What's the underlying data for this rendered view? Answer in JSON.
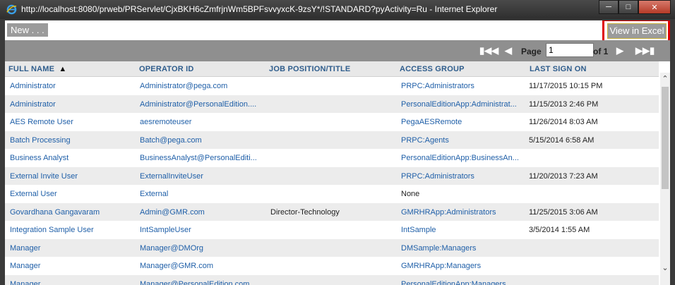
{
  "window": {
    "title": "http://localhost:8080/prweb/PRServlet/CjxBKH6cZmfrjnWm5BPFsvvyxcK-9zsY*/!STANDARD?pyActivity=Ru - Internet Explorer",
    "minimize_icon": "minimize-icon",
    "maximize_icon": "maximize-icon",
    "close_icon": "close-icon"
  },
  "toolbar": {
    "new_label": "New . . .",
    "excel_label": "View in Excel"
  },
  "pager": {
    "page_label": "Page",
    "page_value": "1",
    "of_label": "of 1"
  },
  "columns": {
    "full_name": "FULL NAME",
    "sort_indicator": "▲",
    "operator_id": "OPERATOR ID",
    "job_position": "JOB POSITION/TITLE",
    "access_group": "ACCESS GROUP",
    "last_sign_on": "LAST SIGN ON"
  },
  "rows": [
    {
      "full_name": "Administrator",
      "operator_id": "Administrator@pega.com",
      "job": "",
      "access_group": "PRPC:Administrators",
      "last_sign_on": "11/17/2015 10:15 PM"
    },
    {
      "full_name": "Administrator",
      "operator_id": "Administrator@PersonalEdition....",
      "job": "",
      "access_group": "PersonalEditionApp:Administrat...",
      "last_sign_on": "11/15/2013 2:46 PM"
    },
    {
      "full_name": "AES Remote User",
      "operator_id": "aesremoteuser",
      "job": "",
      "access_group": "PegaAESRemote",
      "last_sign_on": "11/26/2014 8:03 AM"
    },
    {
      "full_name": "Batch Processing",
      "operator_id": "Batch@pega.com",
      "job": "",
      "access_group": "PRPC:Agents",
      "last_sign_on": "5/15/2014 6:58 AM"
    },
    {
      "full_name": "Business Analyst",
      "operator_id": "BusinessAnalyst@PersonalEditi...",
      "job": "",
      "access_group": "PersonalEditionApp:BusinessAn...",
      "last_sign_on": ""
    },
    {
      "full_name": "External Invite User",
      "operator_id": "ExternalInviteUser",
      "job": "",
      "access_group": "PRPC:Administrators",
      "last_sign_on": "11/20/2013 7:23 AM"
    },
    {
      "full_name": "External User",
      "operator_id": "External",
      "job": "",
      "access_group": "None",
      "last_sign_on": ""
    },
    {
      "full_name": "Govardhana Gangavaram",
      "operator_id": "Admin@GMR.com",
      "job": "Director-Technology",
      "access_group": "GMRHRApp:Administrators",
      "last_sign_on": "11/25/2015 3:06 AM"
    },
    {
      "full_name": "Integration Sample User",
      "operator_id": "IntSampleUser",
      "job": "",
      "access_group": "IntSample",
      "last_sign_on": "3/5/2014 1:55 AM"
    },
    {
      "full_name": "Manager",
      "operator_id": "Manager@DMOrg",
      "job": "",
      "access_group": "DMSample:Managers",
      "last_sign_on": ""
    },
    {
      "full_name": "Manager",
      "operator_id": "Manager@GMR.com",
      "job": "",
      "access_group": "GMRHRApp:Managers",
      "last_sign_on": ""
    },
    {
      "full_name": "Manager",
      "operator_id": "Manager@PersonalEdition.com",
      "job": "",
      "access_group": "PersonalEditionApp:Managers",
      "last_sign_on": ""
    }
  ],
  "colors": {
    "link": "#1f5fa8",
    "header_text": "#2f5d8c",
    "highlight": "#e00000"
  }
}
